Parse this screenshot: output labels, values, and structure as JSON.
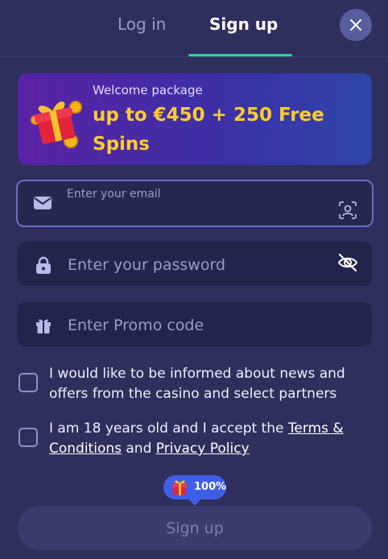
{
  "tabs": {
    "login": "Log in",
    "signup": "Sign up",
    "active": "signup"
  },
  "banner": {
    "subtitle": "Welcome package",
    "title": "up to €450 + 250 Free Spins"
  },
  "form": {
    "email": {
      "label": "Enter your email",
      "value": ""
    },
    "password": {
      "placeholder": "Enter your password"
    },
    "promo": {
      "placeholder": "Enter Promo code"
    }
  },
  "consent": {
    "news": {
      "text": "I would like to be informed about news and offers from the casino and select partners",
      "checked": false
    },
    "age": {
      "prefix": "I am 18 years old and I accept the ",
      "terms": "Terms & Conditions",
      "middle": " and ",
      "privacy": "Privacy Policy",
      "checked": false
    }
  },
  "bonus_badge": {
    "text": "100%"
  },
  "submit": {
    "label": "Sign up"
  },
  "icons": {
    "close": "close-icon",
    "email": "envelope-icon",
    "scan": "face-scan-icon",
    "password": "lock-icon",
    "eye": "eye-off-icon",
    "promo": "gift-icon"
  },
  "colors": {
    "background": "#2e2f5c",
    "accent": "#27d89c",
    "banner_title": "#ffcc2e",
    "badge": "#3f5ee8"
  }
}
